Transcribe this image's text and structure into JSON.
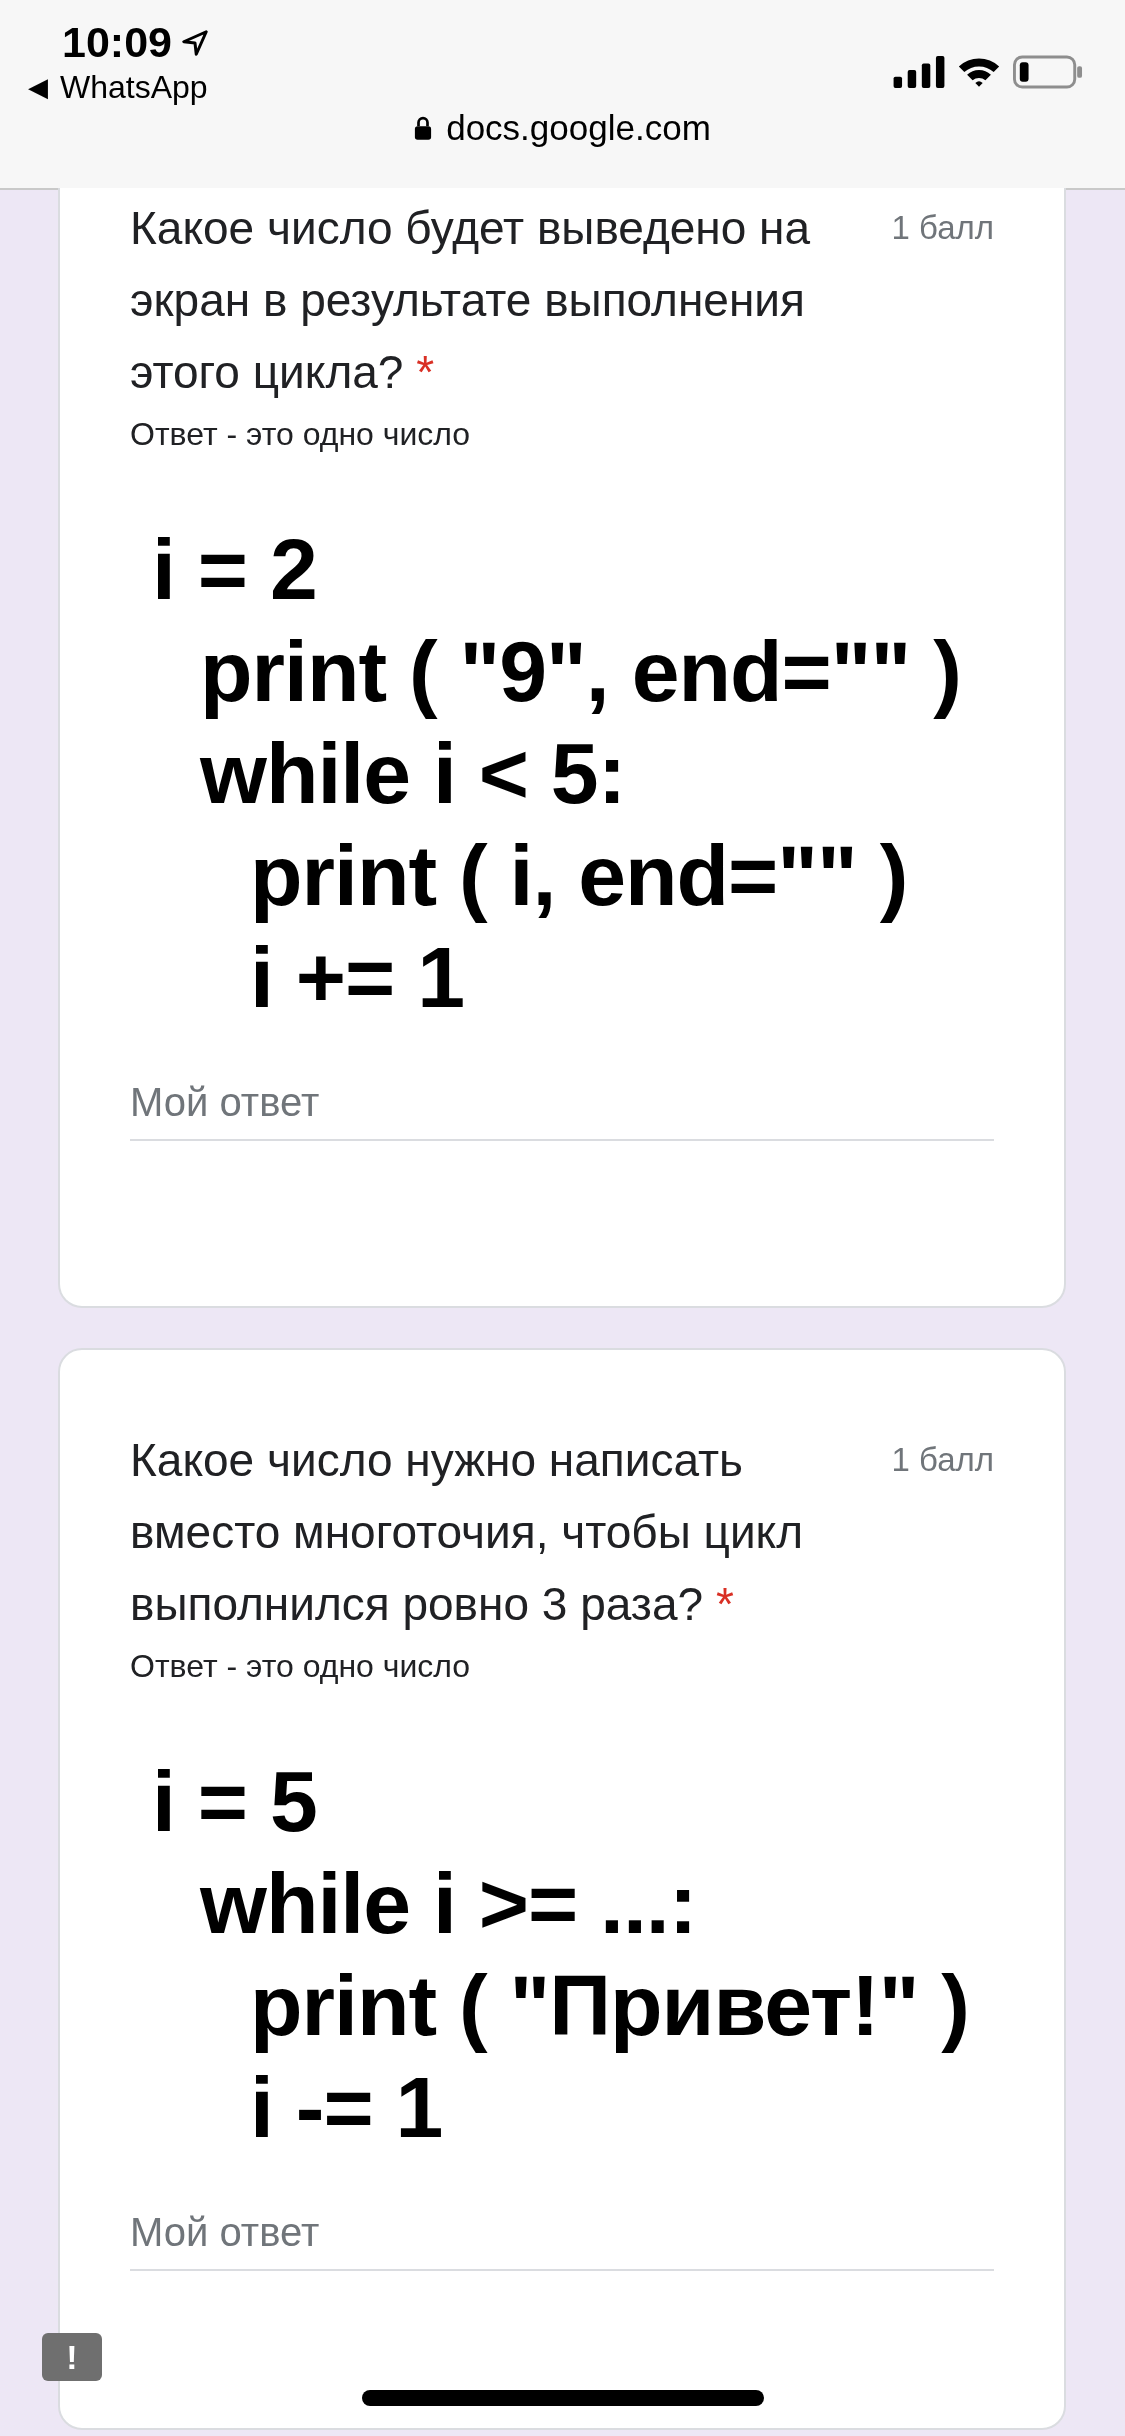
{
  "status_bar": {
    "time": "10:09",
    "back_arrow": "◀",
    "back_app": "WhatsApp"
  },
  "address_bar": {
    "url": "docs.google.com"
  },
  "questions": [
    {
      "cut_top": true,
      "title": "Какое число будет выведено на экран в результате выполнения этого цикла?",
      "required_mark": "*",
      "points": "1 балл",
      "hint": "Ответ - это одно число",
      "code": [
        {
          "text": "i = 2",
          "children": [
            {
              "text": "print ( \"9\", end=\"\" )"
            },
            {
              "text": "while i < 5:",
              "children": [
                {
                  "text": "print ( i, end=\"\" )"
                },
                {
                  "text": "i += 1"
                }
              ]
            }
          ]
        }
      ],
      "answer": {
        "placeholder": "Мой ответ"
      }
    },
    {
      "cut_top": false,
      "title": "Какое число нужно написать вместо многоточия, чтобы цикл выполнился ровно 3 раза?",
      "required_mark": "*",
      "points": "1 балл",
      "hint": "Ответ - это одно число",
      "code": [
        {
          "text": "i = 5",
          "children": [
            {
              "text": "while i >= ...:",
              "children": [
                {
                  "text": "print ( \"Привет!\" )"
                },
                {
                  "text": "i -= 1"
                }
              ]
            }
          ]
        }
      ],
      "answer": {
        "placeholder": "Мой ответ"
      }
    }
  ],
  "feedback_button": {
    "label": "!"
  }
}
